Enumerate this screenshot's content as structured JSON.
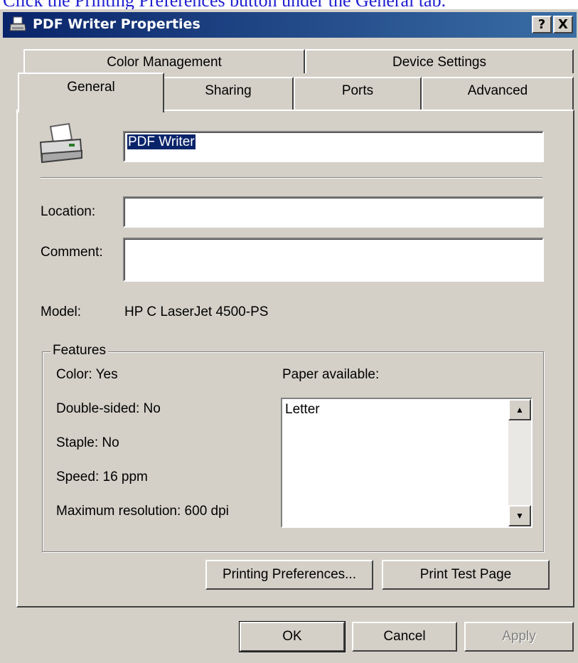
{
  "caption": {
    "text": "Click the Printing Preferences button under the General tab."
  },
  "window": {
    "title": "PDF Writer Properties",
    "help_glyph": "?",
    "close_glyph": "X"
  },
  "tabs": {
    "back_row": [
      "Color Management",
      "Device Settings"
    ],
    "front_row": [
      "General",
      "Sharing",
      "Ports",
      "Advanced"
    ],
    "active": "General"
  },
  "general": {
    "printer_name": "PDF Writer",
    "location_label": "Location:",
    "location_value": "",
    "comment_label": "Comment:",
    "comment_value": "",
    "model_label": "Model:",
    "model_value": "HP C LaserJet 4500-PS"
  },
  "features": {
    "title": "Features",
    "color": "Color: Yes",
    "double_sided": "Double-sided: No",
    "staple": "Staple: No",
    "speed": "Speed: 16 ppm",
    "max_resolution": "Maximum resolution: 600 dpi",
    "paper_label": "Paper available:",
    "paper_items": [
      "Letter"
    ]
  },
  "buttons": {
    "printing_preferences": "Printing Preferences...",
    "print_test_page": "Print Test Page",
    "ok": "OK",
    "cancel": "Cancel",
    "apply": "Apply"
  },
  "colors": {
    "window_face": "#d4d0c8",
    "title_bar": "#0a246a",
    "selection": "#0a246a"
  }
}
